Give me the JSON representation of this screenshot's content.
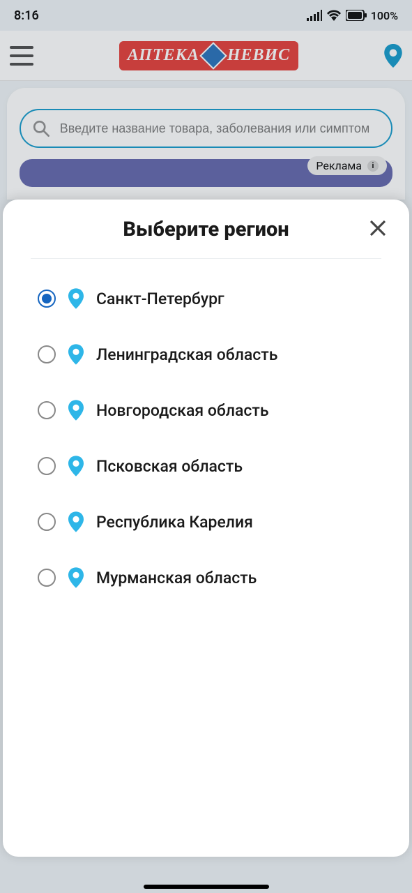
{
  "status": {
    "time": "8:16",
    "battery_pct": "100%"
  },
  "header": {
    "brand_left": "АПТЕКА",
    "brand_right": "НЕВИС"
  },
  "search": {
    "placeholder": "Введите название товара, заболевания или симптом"
  },
  "promo": {
    "ad_label": "Реклама"
  },
  "sheet": {
    "title": "Выберите регион",
    "regions": [
      {
        "name": "Санкт-Петербург",
        "selected": true
      },
      {
        "name": "Ленинградская область",
        "selected": false
      },
      {
        "name": "Новгородская область",
        "selected": false
      },
      {
        "name": "Псковская область",
        "selected": false
      },
      {
        "name": "Республика Карелия",
        "selected": false
      },
      {
        "name": "Мурманская область",
        "selected": false
      }
    ]
  }
}
